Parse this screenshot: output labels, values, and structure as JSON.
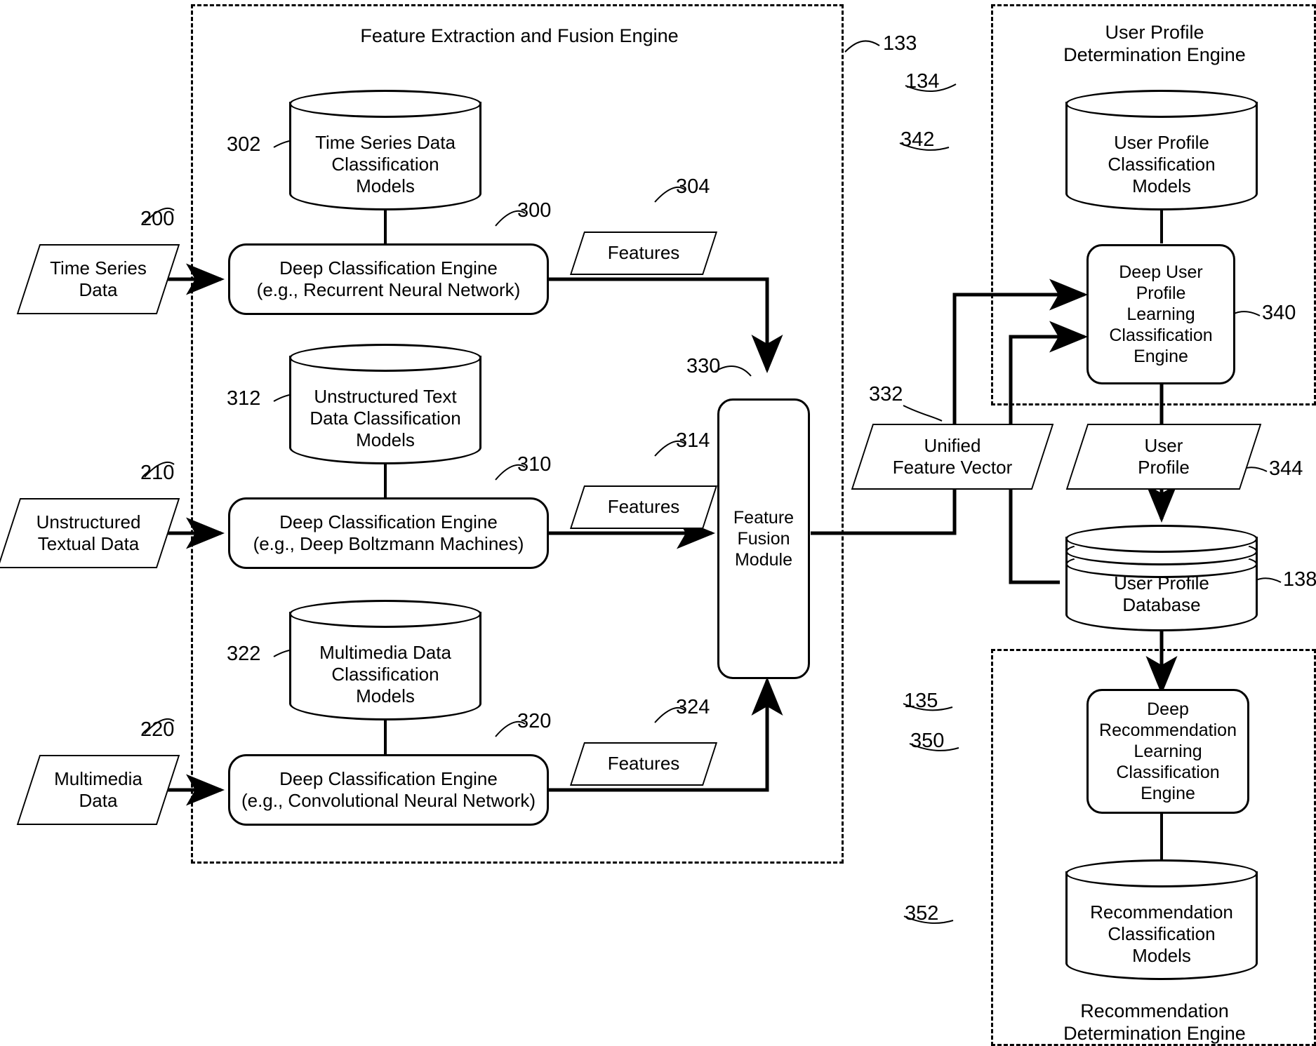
{
  "figure": {
    "groups": [
      {
        "id": "feature-extraction-fusion-engine",
        "title": "Feature Extraction and Fusion Engine",
        "ref": "133"
      },
      {
        "id": "user-profile-determination-engine",
        "title": "User Profile\nDetermination Engine",
        "ref": "134"
      },
      {
        "id": "recommendation-determination-engine",
        "title": "Recommendation\nDetermination Engine",
        "ref": "135"
      }
    ],
    "inputs": [
      {
        "label": "Time Series\nData",
        "ref": "200"
      },
      {
        "label": "Unstructured\nTextual Data",
        "ref": "210"
      },
      {
        "label": "Multimedia\nData",
        "ref": "220"
      }
    ],
    "model_stores": [
      {
        "label": "Time Series Data\nClassification\nModels",
        "ref": "302"
      },
      {
        "label": "Unstructured Text\nData Classification\nModels",
        "ref": "312"
      },
      {
        "label": "Multimedia Data\nClassification\nModels",
        "ref": "322"
      },
      {
        "label": "User Profile\nClassification\nModels",
        "ref": "342"
      },
      {
        "label": "Recommendation\nClassification\nModels",
        "ref": "352"
      }
    ],
    "engines": [
      {
        "label": "Deep Classification Engine\n(e.g., Recurrent Neural Network)",
        "ref": "300"
      },
      {
        "label": "Deep Classification Engine\n(e.g., Deep Boltzmann Machines)",
        "ref": "310"
      },
      {
        "label": "Deep Classification Engine\n(e.g., Convolutional Neural Network)",
        "ref": "320"
      },
      {
        "label": "Feature\nFusion\nModule",
        "ref": "330"
      },
      {
        "label": "Deep User\nProfile\nLearning\nClassification\nEngine",
        "ref": "340"
      },
      {
        "label": "Deep\nRecommendation\nLearning\nClassification\nEngine",
        "ref": "350"
      }
    ],
    "data_artifacts": [
      {
        "label": "Features",
        "ref": "304"
      },
      {
        "label": "Features",
        "ref": "314"
      },
      {
        "label": "Features",
        "ref": "324"
      },
      {
        "label": "Unified\nFeature Vector",
        "ref": "332"
      },
      {
        "label": "User\nProfile",
        "ref": "344"
      }
    ],
    "databases": [
      {
        "label": "User Profile\nDatabase",
        "ref": "138"
      }
    ],
    "colors": {
      "stroke": "#000000",
      "fill": "#ffffff"
    }
  }
}
